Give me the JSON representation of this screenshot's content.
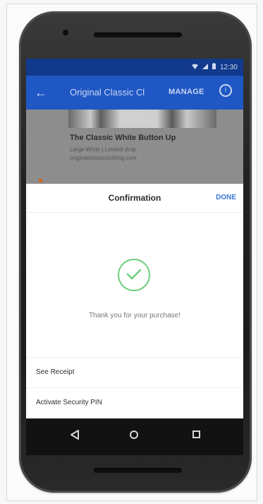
{
  "status_bar": {
    "time": "12:30",
    "icons": [
      "wifi-icon",
      "signal-icon",
      "battery-icon"
    ]
  },
  "app_bar": {
    "back_icon": "arrow-left-icon",
    "title": "Original Classic Cl",
    "manage_label": "MANAGE",
    "info_icon": "info-icon"
  },
  "product": {
    "title": "The Classic White Button Up",
    "subtitle": "Large White | Limited drop",
    "store": "originalclassicclothing.com"
  },
  "sheet": {
    "title": "Confirmation",
    "done_label": "DONE",
    "check_icon": "check-circle-icon",
    "message": "Thank you for your purchase!",
    "items": [
      {
        "label": "See Receipt"
      },
      {
        "label": "Activate Security PIN"
      }
    ]
  },
  "nav_bar": {
    "icons": [
      "back-triangle-icon",
      "home-circle-icon",
      "recents-square-icon"
    ]
  },
  "colors": {
    "app_bar": "#1f57c4",
    "status_bar": "#123a8c",
    "done": "#3a78d6",
    "check": "#6fcf7d"
  }
}
